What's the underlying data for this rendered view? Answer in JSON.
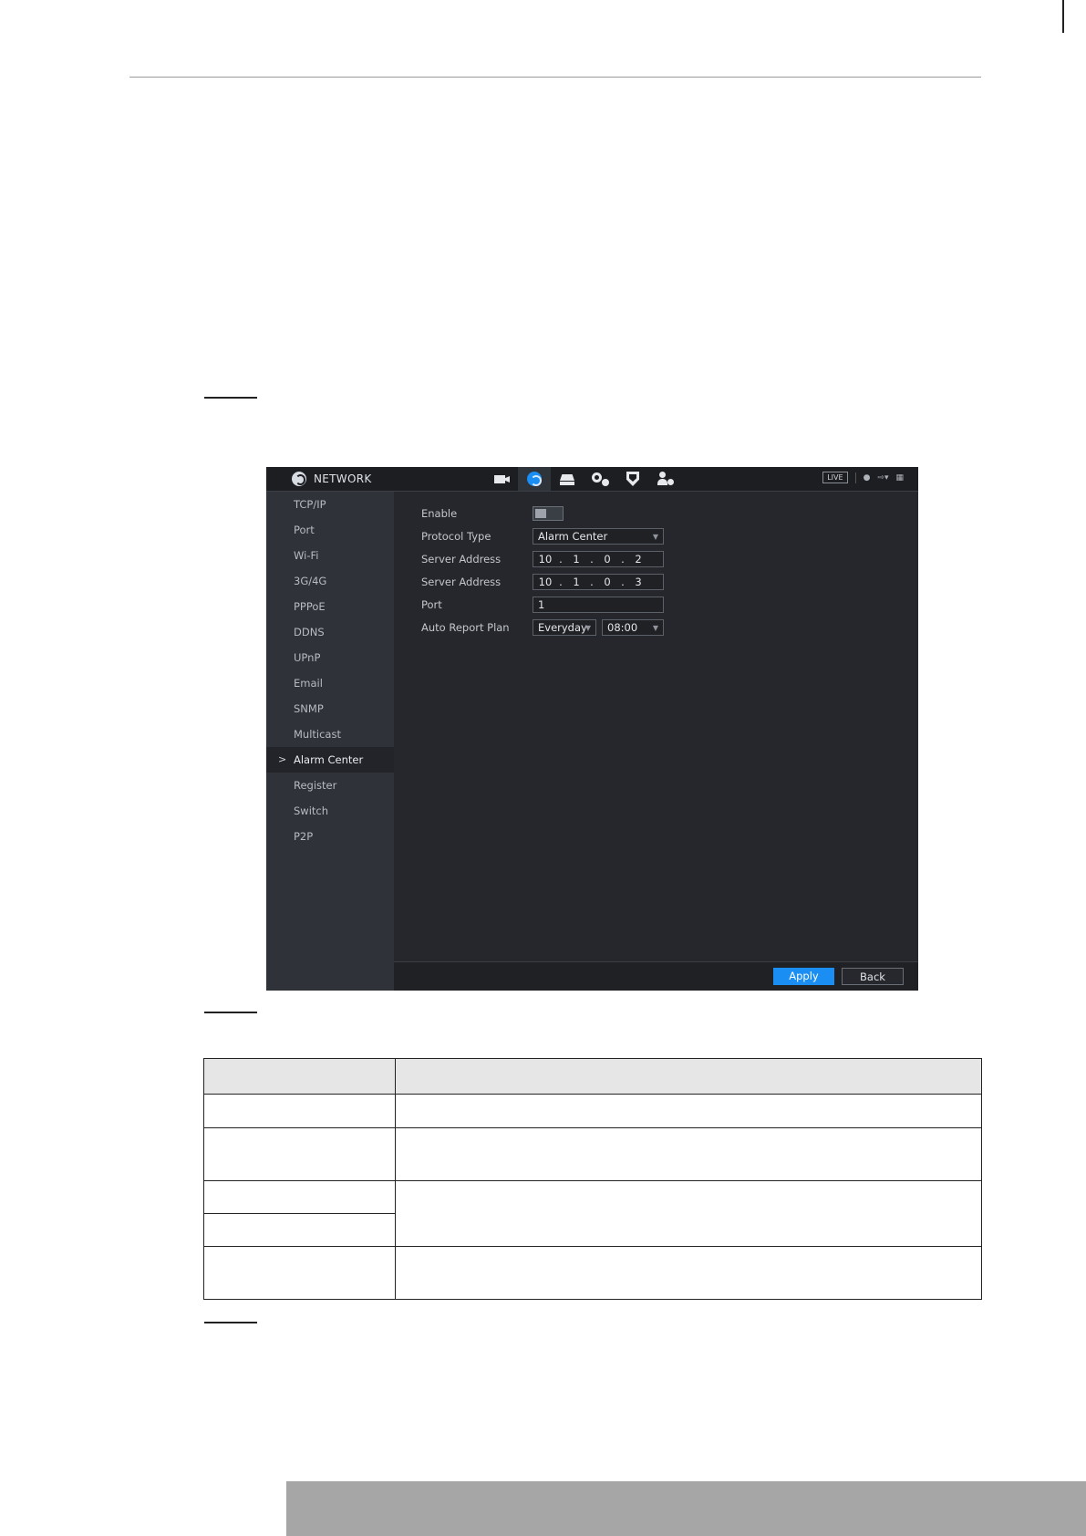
{
  "screen": {
    "header": {
      "title": "NETWORK",
      "live_label": "LIVE"
    },
    "nav_icons": [
      "camera-icon",
      "network-icon",
      "storage-icon",
      "settings-icon",
      "security-icon",
      "account-icon"
    ],
    "top_right_icons": [
      "user-icon",
      "logout-icon",
      "fullscreen-icon"
    ],
    "sidebar": {
      "items": [
        {
          "label": "TCP/IP"
        },
        {
          "label": "Port"
        },
        {
          "label": "Wi-Fi"
        },
        {
          "label": "3G/4G"
        },
        {
          "label": "PPPoE"
        },
        {
          "label": "DDNS"
        },
        {
          "label": "UPnP"
        },
        {
          "label": "Email"
        },
        {
          "label": "SNMP"
        },
        {
          "label": "Multicast"
        },
        {
          "label": "Alarm Center"
        },
        {
          "label": "Register"
        },
        {
          "label": "Switch"
        },
        {
          "label": "P2P"
        }
      ],
      "active_marker": ">"
    },
    "form": {
      "enable": {
        "label": "Enable"
      },
      "protocol_type": {
        "label": "Protocol Type",
        "value": "Alarm Center"
      },
      "server_address_1": {
        "label": "Server Address",
        "octets": [
          "10",
          "1",
          "0",
          "2"
        ]
      },
      "server_address_2": {
        "label": "Server Address",
        "octets": [
          "10",
          "1",
          "0",
          "3"
        ]
      },
      "port": {
        "label": "Port",
        "value": "1"
      },
      "auto_report_plan": {
        "label": "Auto Report Plan",
        "day": "Everyday",
        "time": "08:00"
      }
    },
    "buttons": {
      "apply": "Apply",
      "back": "Back"
    },
    "colors": {
      "accent": "#1a8ef2",
      "background": "#25272c",
      "sidebar": "#2f3238"
    }
  }
}
